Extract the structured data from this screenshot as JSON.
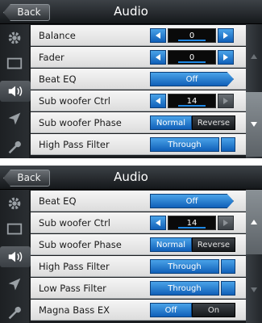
{
  "title": "Audio",
  "back_label": "Back",
  "sidebar_icons": [
    "gear-icon",
    "display-icon",
    "speaker-icon",
    "navigation-icon",
    "wrench-icon"
  ],
  "screens": [
    {
      "rows": [
        {
          "label": "Balance",
          "value": "0"
        },
        {
          "label": "Fader",
          "value": "0"
        },
        {
          "label": "Beat EQ",
          "value": "Off"
        },
        {
          "label": "Sub woofer Ctrl",
          "value": "14"
        },
        {
          "label": "Sub woofer Phase",
          "options": [
            "Normal",
            "Reverse"
          ],
          "selected": "Normal"
        },
        {
          "label": "High Pass Filter",
          "value": "Through"
        }
      ]
    },
    {
      "rows": [
        {
          "label": "Beat EQ",
          "value": "Off"
        },
        {
          "label": "Sub woofer Ctrl",
          "value": "14"
        },
        {
          "label": "Sub woofer Phase",
          "options": [
            "Normal",
            "Reverse"
          ],
          "selected": "Normal"
        },
        {
          "label": "High Pass Filter",
          "value": "Through"
        },
        {
          "label": "Low Pass Filter",
          "value": "Through"
        },
        {
          "label": "Magna Bass EX",
          "options": [
            "Off",
            "On"
          ],
          "selected": "Off"
        }
      ]
    }
  ]
}
